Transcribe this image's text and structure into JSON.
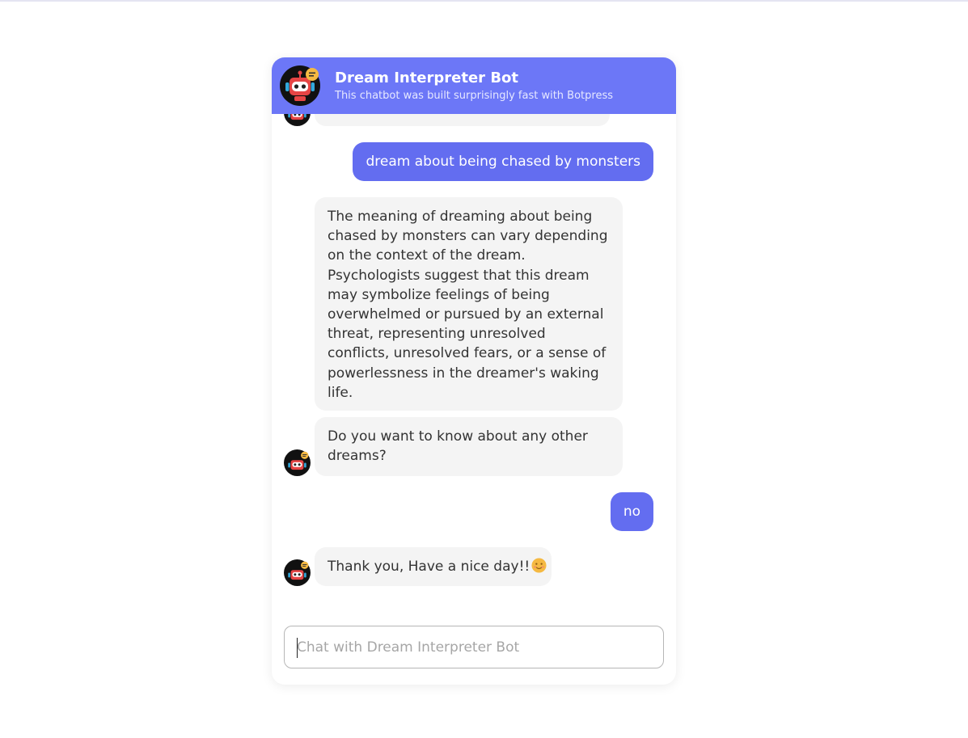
{
  "header": {
    "title": "Dream Interpreter Bot",
    "subtitle": "This chatbot was built surprisingly fast with Botpress",
    "bg_color": "#6c77f7"
  },
  "messages": [
    {
      "from": "user",
      "text": "dream about being chased by monsters"
    },
    {
      "from": "bot",
      "text": "The meaning of dreaming about being chased by monsters can vary depending on the context of the dream. Psychologists suggest that this dream may symbolize feelings of being overwhelmed or pursued by an external threat, representing unresolved conflicts, unresolved fears, or a sense of powerlessness in the dreamer's waking life."
    },
    {
      "from": "bot",
      "text": "Do you want to know about any other dreams?"
    },
    {
      "from": "user",
      "text": "no"
    },
    {
      "from": "bot",
      "text": "Thank you, Have a nice day!!",
      "emoji": "smiling-face-emoji"
    }
  ],
  "composer": {
    "placeholder": "Chat with Dream Interpreter Bot",
    "value": ""
  },
  "colors": {
    "user_bubble": "#636df0",
    "bot_bubble": "#f4f4f4"
  },
  "icons": {
    "bot_avatar": "robot-avatar-icon"
  }
}
